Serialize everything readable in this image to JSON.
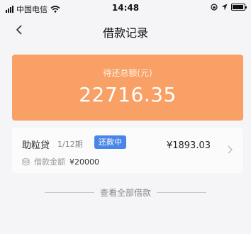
{
  "status_bar": {
    "carrier": "中国电信",
    "time": "14:48"
  },
  "nav": {
    "title": "借款记录"
  },
  "summary": {
    "label": "待还总额(元)",
    "amount": "22716.35"
  },
  "loan": {
    "name": "助粒贷",
    "period": "1/12期",
    "status": "还款中",
    "amount": "¥1893.03",
    "principal_label": "借款金额",
    "principal_value": "¥20000"
  },
  "footer": {
    "view_all": "查看全部借款"
  },
  "colors": {
    "summary_bg": "#f8a066",
    "badge_bg": "#4a86e8"
  }
}
